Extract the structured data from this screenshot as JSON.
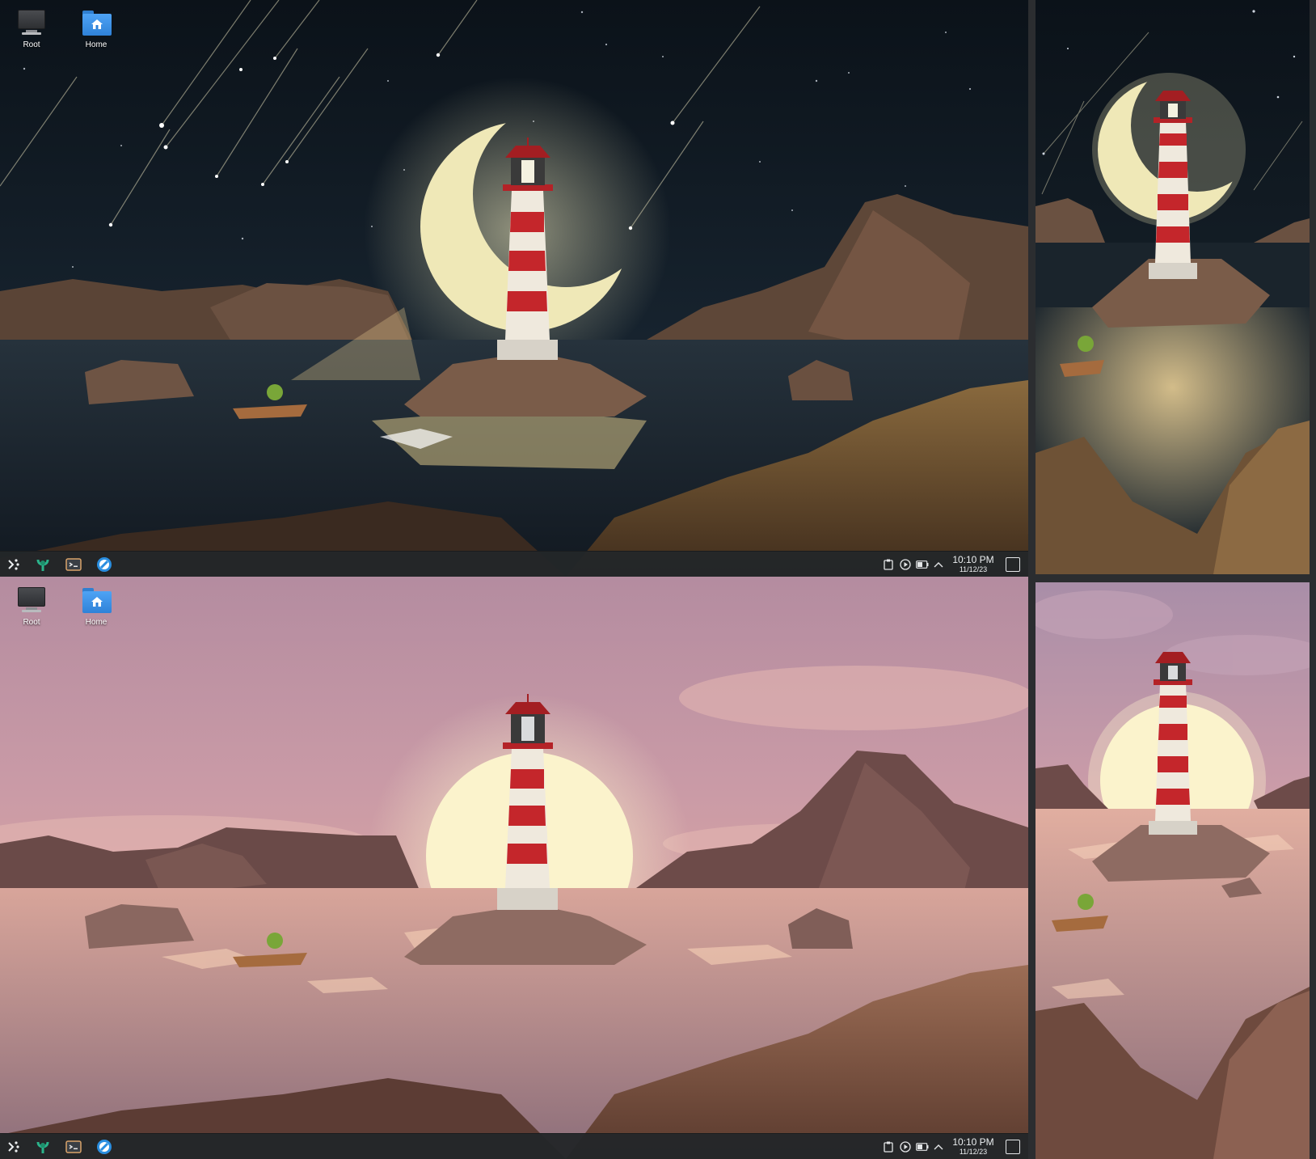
{
  "desktop_icons": {
    "root_label": "Root",
    "home_label": "Home"
  },
  "taskbar": {
    "time": "10:10 PM",
    "date": "11/12/23"
  },
  "colors": {
    "panel_bg": "#232629",
    "folder_blue": "#3d8fe6",
    "lighthouse_red": "#c4262b",
    "night_sky": "#0d1620",
    "sunset_sky": "#b98a9c"
  },
  "icons": [
    "application-launcher-icon",
    "discover-icon",
    "konsole-icon",
    "browser-icon",
    "clipboard-icon",
    "media-player-icon",
    "battery-icon",
    "show-hidden-arrow-icon",
    "show-desktop-icon"
  ]
}
